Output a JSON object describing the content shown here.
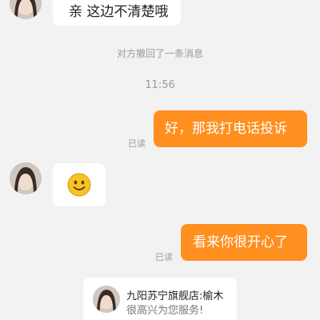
{
  "messages": {
    "top_incoming": "亲 这边不清楚哦",
    "recall_notice": "对方撤回了一条消息",
    "timestamp": "11:56",
    "outgoing_1": "好，那我打电话投诉",
    "outgoing_1_status": "已读",
    "incoming_emoji": "smiley-emoji",
    "outgoing_2": "看来你很开心了",
    "outgoing_2_status": "已读"
  },
  "shop_card": {
    "title": "九阳苏宁旗舰店:榆木",
    "subtitle": "很高兴为您服务!"
  },
  "colors": {
    "outgoing_bubble": "#ff8f1f",
    "incoming_bubble": "#ffffff",
    "background": "#f2f2f2"
  }
}
